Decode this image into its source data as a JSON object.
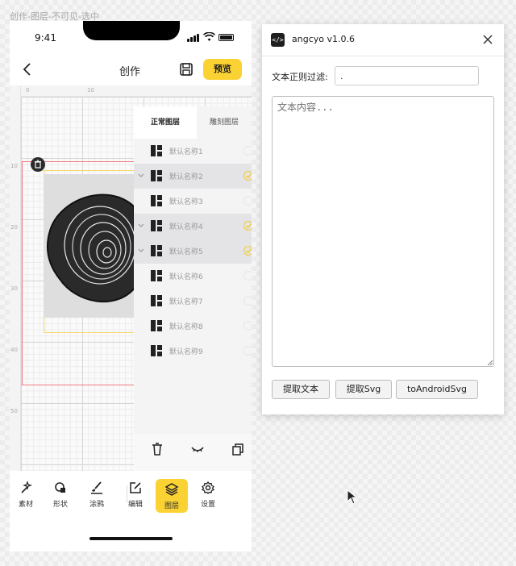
{
  "frame_label": "创作-图层-不可见-选中",
  "status_bar": {
    "time": "9:41"
  },
  "header": {
    "title": "创作",
    "preview_label": "预览"
  },
  "rulers": {
    "top_ticks": [
      "0",
      "10"
    ],
    "left_ticks": [
      "10",
      "20",
      "30",
      "40",
      "50"
    ]
  },
  "layer_panel": {
    "tabs": [
      {
        "label": "正常图层",
        "active": true
      },
      {
        "label": "雕刻图层",
        "active": false
      }
    ],
    "items": [
      {
        "name": "默认名称1",
        "selected": false,
        "checked": false
      },
      {
        "name": "默认名称2",
        "selected": true,
        "checked": true
      },
      {
        "name": "默认名称3",
        "selected": false,
        "checked": false
      },
      {
        "name": "默认名称4",
        "selected": true,
        "checked": true
      },
      {
        "name": "默认名称5",
        "selected": true,
        "checked": true
      },
      {
        "name": "默认名称6",
        "selected": false,
        "checked": false
      },
      {
        "name": "默认名称7",
        "selected": false,
        "checked": false
      },
      {
        "name": "默认名称8",
        "selected": false,
        "checked": false
      },
      {
        "name": "默认名称9",
        "selected": false,
        "checked": false
      }
    ],
    "actions": [
      "trash-icon",
      "eye-closed-icon",
      "copy-icon"
    ]
  },
  "toolbar": {
    "items": [
      {
        "label": "素材",
        "icon": "magic-wand-icon"
      },
      {
        "label": "形状",
        "icon": "shapes-icon"
      },
      {
        "label": "涂鸦",
        "icon": "brush-icon"
      },
      {
        "label": "编辑",
        "icon": "edit-icon"
      },
      {
        "label": "图层",
        "icon": "layers-icon",
        "active": true
      },
      {
        "label": "设置",
        "icon": "gear-icon"
      }
    ]
  },
  "dialog": {
    "icon_text": "</>",
    "title": "angcyo v1.0.6",
    "filter_label": "文本正则过滤:",
    "filter_value": ".",
    "text_placeholder": "文本内容...",
    "buttons": [
      "提取文本",
      "提取Svg",
      "toAndroidSvg"
    ]
  },
  "colors": {
    "accent": "#FBD233",
    "selection_red": "#F07A85",
    "check_yellow": "#F2C936"
  }
}
